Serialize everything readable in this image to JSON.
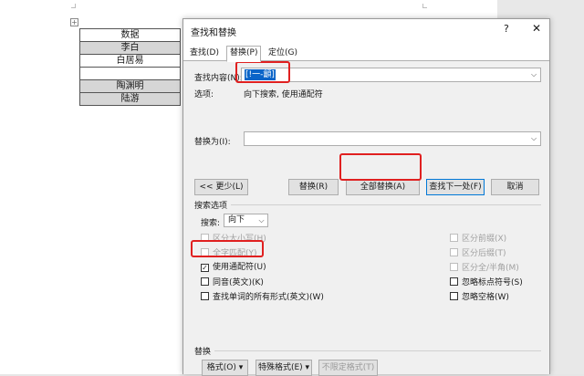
{
  "document": {
    "table_rows": [
      "数据",
      "李白",
      "白居易",
      "",
      "陶渊明",
      "陆游"
    ]
  },
  "dialog": {
    "title": "查找和替换",
    "help": "?",
    "close": "✕",
    "tabs": [
      "查找(D)",
      "替换(P)",
      "定位(G)"
    ],
    "find_label": "查找内容(N):",
    "find_value": "[!一-龥]",
    "options_label": "选项:",
    "options_value": "向下搜索, 使用通配符",
    "replace_label": "替换为(I):",
    "replace_value": "",
    "buttons": {
      "less": "<< 更少(L)",
      "replace": "替换(R)",
      "replace_all": "全部替换(A)",
      "find_next": "查找下一处(F)",
      "cancel": "取消"
    },
    "search_options_heading": "搜索选项",
    "search_label": "搜索:",
    "search_value": "向下",
    "checkboxes_left": [
      {
        "label": "区分大小写(H)",
        "checked": false,
        "disabled": true
      },
      {
        "label": "全字匹配(Y)",
        "checked": false,
        "disabled": true
      },
      {
        "label": "使用通配符(U)",
        "checked": true,
        "disabled": false
      },
      {
        "label": "同音(英文)(K)",
        "checked": false,
        "disabled": false
      },
      {
        "label": "查找单词的所有形式(英文)(W)",
        "checked": false,
        "disabled": false
      }
    ],
    "checkboxes_right": [
      {
        "label": "区分前缀(X)",
        "checked": false,
        "disabled": true
      },
      {
        "label": "区分后缀(T)",
        "checked": false,
        "disabled": true
      },
      {
        "label": "区分全/半角(M)",
        "checked": false,
        "disabled": true
      },
      {
        "label": "忽略标点符号(S)",
        "checked": false,
        "disabled": false
      },
      {
        "label": "忽略空格(W)",
        "checked": false,
        "disabled": false
      }
    ],
    "replace_heading": "替换",
    "format_button": "格式(O) ▾",
    "special_button": "特殊格式(E) ▾",
    "no_format_button": "不限定格式(T)"
  },
  "colors": {
    "highlight_red": "#e02020",
    "selection_blue": "#0a64c8",
    "default_button_border": "#0078d7"
  }
}
